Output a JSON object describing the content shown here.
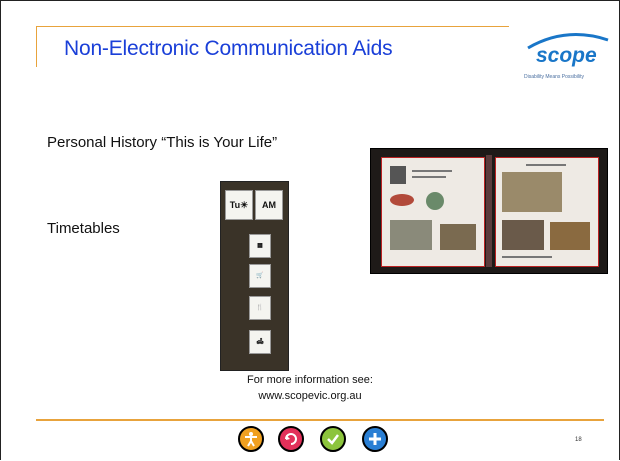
{
  "slide": {
    "title": "Non-Electronic Communication Aids",
    "page_number": "18"
  },
  "logo": {
    "word": "scope",
    "tagline": "Disability Means Possibility",
    "color": "#1976c8"
  },
  "bullets": [
    "Personal History “This is Your Life”",
    "Timetables"
  ],
  "timetable": {
    "cards": [
      "Tu☀",
      "AM",
      "▦",
      "🛒",
      "🍴",
      "🛋"
    ]
  },
  "footer": {
    "line1": "For more information see:",
    "line2": "www.scopevic.org.au"
  },
  "icons": [
    {
      "name": "accessibility-icon",
      "color": "#f0a020"
    },
    {
      "name": "refresh-icon",
      "color": "#e2305a"
    },
    {
      "name": "check-icon",
      "color": "#8cc43c"
    },
    {
      "name": "plus-icon",
      "color": "#2a7fd4"
    }
  ],
  "accent_color": "#e8a33c",
  "title_color": "#1a3fd8"
}
